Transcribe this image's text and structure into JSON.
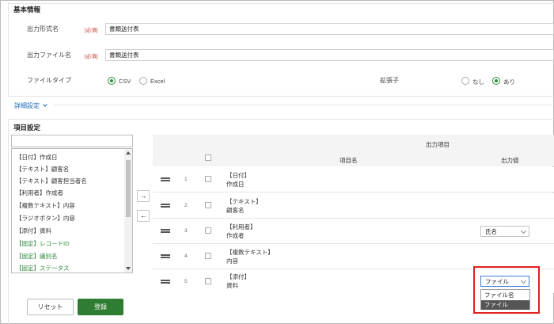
{
  "basic_info": {
    "section_title": "基本情報",
    "output_format": {
      "label": "出力形式名",
      "required": "[必須]",
      "value": "書類送付表"
    },
    "output_file": {
      "label": "出力ファイル名",
      "required": "[必須]",
      "value": "書類送付表"
    },
    "file_type": {
      "label": "ファイルタイプ",
      "options": [
        "CSV",
        "Excel"
      ],
      "selected": "CSV"
    },
    "extension": {
      "label": "拡張子",
      "options": [
        "なし",
        "あり"
      ],
      "selected": "あり"
    }
  },
  "detail_settings_link": "詳細設定",
  "item_settings": {
    "section_title": "項目設定",
    "available_items": [
      {
        "label": "【日付】作成日",
        "green": false
      },
      {
        "label": "【テキスト】顧客名",
        "green": false
      },
      {
        "label": "【テキスト】顧客担当者名",
        "green": false
      },
      {
        "label": "【利用者】作成者",
        "green": false
      },
      {
        "label": "【複数テキスト】内容",
        "green": false
      },
      {
        "label": "【ラジオボタン】内容",
        "green": false
      },
      {
        "label": "【添付】資料",
        "green": false
      },
      {
        "label": "【固定】レコードID",
        "green": true
      },
      {
        "label": "【固定】識別名",
        "green": true
      },
      {
        "label": "【固定】ステータス",
        "green": true
      }
    ],
    "move_right": "→",
    "move_left": "←",
    "table": {
      "group_header": "出力項目",
      "col_name": "項目名",
      "col_value": "出力値",
      "rows": [
        {
          "num": "1",
          "type": "【日付】",
          "name": "作成日",
          "output": ""
        },
        {
          "num": "2",
          "type": "【テキスト】",
          "name": "顧客名",
          "output": ""
        },
        {
          "num": "3",
          "type": "【利用者】",
          "name": "作成者",
          "output": "氏名"
        },
        {
          "num": "4",
          "type": "【複数テキスト】",
          "name": "内容",
          "output": ""
        },
        {
          "num": "5",
          "type": "【添付】",
          "name": "資料",
          "output": "ファイル"
        }
      ]
    },
    "dropdown_options": [
      "ファイル名",
      "ファイル"
    ],
    "dropdown_highlighted": "ファイル"
  },
  "buttons": {
    "reset": "リセット",
    "register": "登録"
  },
  "colors": {
    "accent_green": "#2e7d32",
    "required_red": "#c0392b",
    "highlight_red": "#e01f1f",
    "link_blue": "#1a6bb8"
  }
}
